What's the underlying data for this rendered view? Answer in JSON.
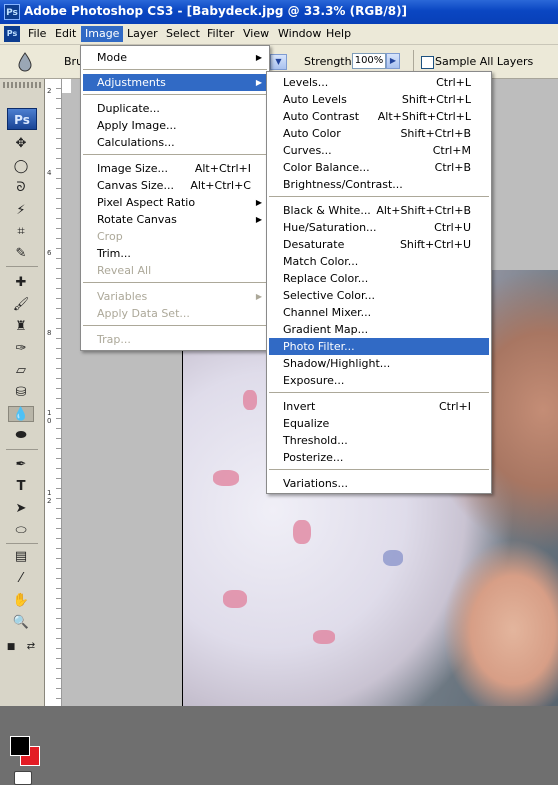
{
  "window": {
    "title": "Adobe Photoshop CS3 - [Babydeck.jpg @ 33.3% (RGB/8)]",
    "app_icon": "Ps"
  },
  "menubar": [
    "File",
    "Edit",
    "Image",
    "Layer",
    "Select",
    "Filter",
    "View",
    "Window",
    "Help"
  ],
  "menubar_active": "Image",
  "options": {
    "brush_label": "Bru",
    "strength_label": "Strength:",
    "strength_value": "100%",
    "sample_all_layers": "Sample All Layers",
    "sample_all_layers_checked": false
  },
  "toolbox": {
    "badge": "Ps",
    "selected_tool": "blur-tool"
  },
  "ruler": {
    "numbers": [
      "2",
      "4",
      "6",
      "8",
      "1",
      "0",
      "1",
      "2"
    ]
  },
  "image_menu": {
    "items": [
      {
        "label": "Mode",
        "shortcut": "",
        "submenu": true,
        "disabled": false
      },
      {
        "label": "Adjustments",
        "shortcut": "",
        "submenu": true,
        "disabled": false,
        "highlight": true
      },
      {
        "label": "Duplicate...",
        "shortcut": "",
        "submenu": false,
        "disabled": false
      },
      {
        "label": "Apply Image...",
        "shortcut": "",
        "submenu": false,
        "disabled": false
      },
      {
        "label": "Calculations...",
        "shortcut": "",
        "submenu": false,
        "disabled": false
      },
      {
        "label": "Image Size...",
        "shortcut": "Alt+Ctrl+I",
        "submenu": false,
        "disabled": false
      },
      {
        "label": "Canvas Size...",
        "shortcut": "Alt+Ctrl+C",
        "submenu": false,
        "disabled": false
      },
      {
        "label": "Pixel Aspect Ratio",
        "shortcut": "",
        "submenu": true,
        "disabled": false
      },
      {
        "label": "Rotate Canvas",
        "shortcut": "",
        "submenu": true,
        "disabled": false
      },
      {
        "label": "Crop",
        "shortcut": "",
        "submenu": false,
        "disabled": true
      },
      {
        "label": "Trim...",
        "shortcut": "",
        "submenu": false,
        "disabled": false
      },
      {
        "label": "Reveal All",
        "shortcut": "",
        "submenu": false,
        "disabled": true
      },
      {
        "label": "Variables",
        "shortcut": "",
        "submenu": true,
        "disabled": true
      },
      {
        "label": "Apply Data Set...",
        "shortcut": "",
        "submenu": false,
        "disabled": true
      },
      {
        "label": "Trap...",
        "shortcut": "",
        "submenu": false,
        "disabled": true
      }
    ]
  },
  "adjustments_menu": {
    "items": [
      {
        "label": "Levels...",
        "shortcut": "Ctrl+L"
      },
      {
        "label": "Auto Levels",
        "shortcut": "Shift+Ctrl+L"
      },
      {
        "label": "Auto Contrast",
        "shortcut": "Alt+Shift+Ctrl+L"
      },
      {
        "label": "Auto Color",
        "shortcut": "Shift+Ctrl+B"
      },
      {
        "label": "Curves...",
        "shortcut": "Ctrl+M"
      },
      {
        "label": "Color Balance...",
        "shortcut": "Ctrl+B"
      },
      {
        "label": "Brightness/Contrast...",
        "shortcut": ""
      },
      {
        "label": "Black & White...",
        "shortcut": "Alt+Shift+Ctrl+B"
      },
      {
        "label": "Hue/Saturation...",
        "shortcut": "Ctrl+U"
      },
      {
        "label": "Desaturate",
        "shortcut": "Shift+Ctrl+U"
      },
      {
        "label": "Match Color...",
        "shortcut": ""
      },
      {
        "label": "Replace Color...",
        "shortcut": ""
      },
      {
        "label": "Selective Color...",
        "shortcut": ""
      },
      {
        "label": "Channel Mixer...",
        "shortcut": ""
      },
      {
        "label": "Gradient Map...",
        "shortcut": ""
      },
      {
        "label": "Photo Filter...",
        "shortcut": "",
        "highlight": true
      },
      {
        "label": "Shadow/Highlight...",
        "shortcut": ""
      },
      {
        "label": "Exposure...",
        "shortcut": ""
      },
      {
        "label": "Invert",
        "shortcut": "Ctrl+I"
      },
      {
        "label": "Equalize",
        "shortcut": ""
      },
      {
        "label": "Threshold...",
        "shortcut": ""
      },
      {
        "label": "Posterize...",
        "shortcut": ""
      },
      {
        "label": "Variations...",
        "shortcut": ""
      }
    ]
  },
  "colors": {
    "foreground": "#000000",
    "background": "#e31c24",
    "highlight": "#316ac5"
  }
}
